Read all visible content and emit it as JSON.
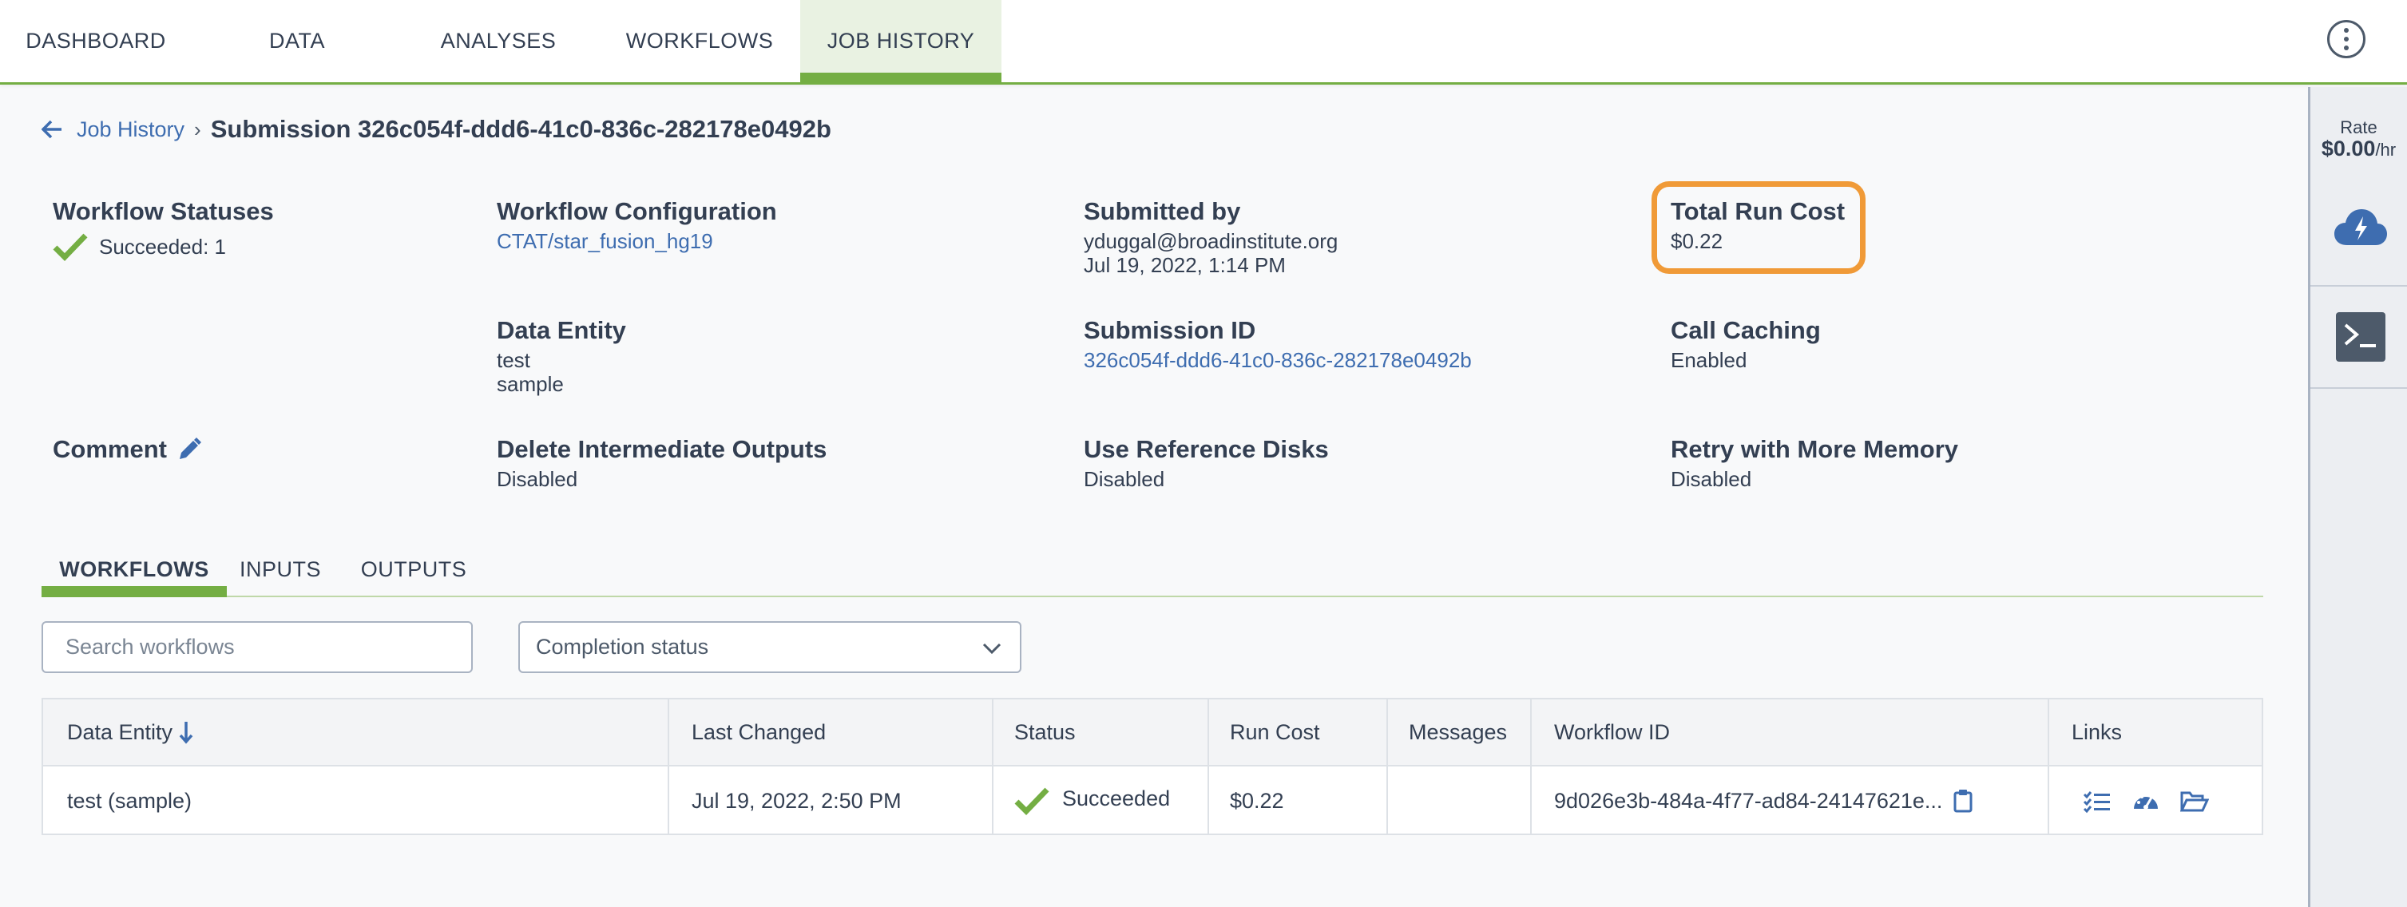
{
  "nav": {
    "tabs": [
      {
        "label": "DASHBOARD"
      },
      {
        "label": "DATA"
      },
      {
        "label": "ANALYSES"
      },
      {
        "label": "WORKFLOWS"
      },
      {
        "label": "JOB HISTORY"
      }
    ],
    "active": "JOB HISTORY"
  },
  "rail": {
    "rate_label": "Rate",
    "rate_value": "$0.00",
    "rate_unit": "/hr",
    "icons": [
      "cloud-lightning-icon",
      "terminal-icon"
    ]
  },
  "breadcrumb": {
    "back_label": "Job History",
    "separator": "›",
    "title": "Submission 326c054f-ddd6-41c0-836c-282178e0492b"
  },
  "info": {
    "workflow_statuses": {
      "heading": "Workflow Statuses",
      "value": "Succeeded: 1"
    },
    "workflow_configuration": {
      "heading": "Workflow Configuration",
      "value": "CTAT/star_fusion_hg19"
    },
    "submitted_by": {
      "heading": "Submitted by",
      "email": "yduggal@broadinstitute.org",
      "date": "Jul 19, 2022, 1:14 PM"
    },
    "total_run_cost": {
      "heading": "Total Run Cost",
      "value": "$0.22"
    },
    "data_entity": {
      "heading": "Data Entity",
      "name": "test",
      "type": "sample"
    },
    "submission_id": {
      "heading": "Submission ID",
      "value": "326c054f-ddd6-41c0-836c-282178e0492b"
    },
    "call_caching": {
      "heading": "Call Caching",
      "value": "Enabled"
    },
    "comment": {
      "heading": "Comment"
    },
    "delete_intermediate": {
      "heading": "Delete Intermediate Outputs",
      "value": "Disabled"
    },
    "use_reference_disks": {
      "heading": "Use Reference Disks",
      "value": "Disabled"
    },
    "retry_memory": {
      "heading": "Retry with More Memory",
      "value": "Disabled"
    }
  },
  "subtabs": [
    {
      "label": "WORKFLOWS"
    },
    {
      "label": "INPUTS"
    },
    {
      "label": "OUTPUTS"
    }
  ],
  "filters": {
    "search_placeholder": "Search workflows",
    "status_placeholder": "Completion status"
  },
  "table": {
    "headers": [
      "Data Entity",
      "Last Changed",
      "Status",
      "Run Cost",
      "Messages",
      "Workflow ID",
      "Links"
    ],
    "rows": [
      {
        "data_entity": "test (sample)",
        "last_changed": "Jul 19, 2022, 2:50 PM",
        "status": "Succeeded",
        "run_cost": "$0.22",
        "messages": "",
        "workflow_id": "9d026e3b-484a-4f77-ad84-24147621e..."
      }
    ]
  },
  "colors": {
    "accent_green": "#74ae43",
    "link_blue": "#3e6db0",
    "highlight_orange": "#f09a37",
    "text": "#333f52"
  }
}
